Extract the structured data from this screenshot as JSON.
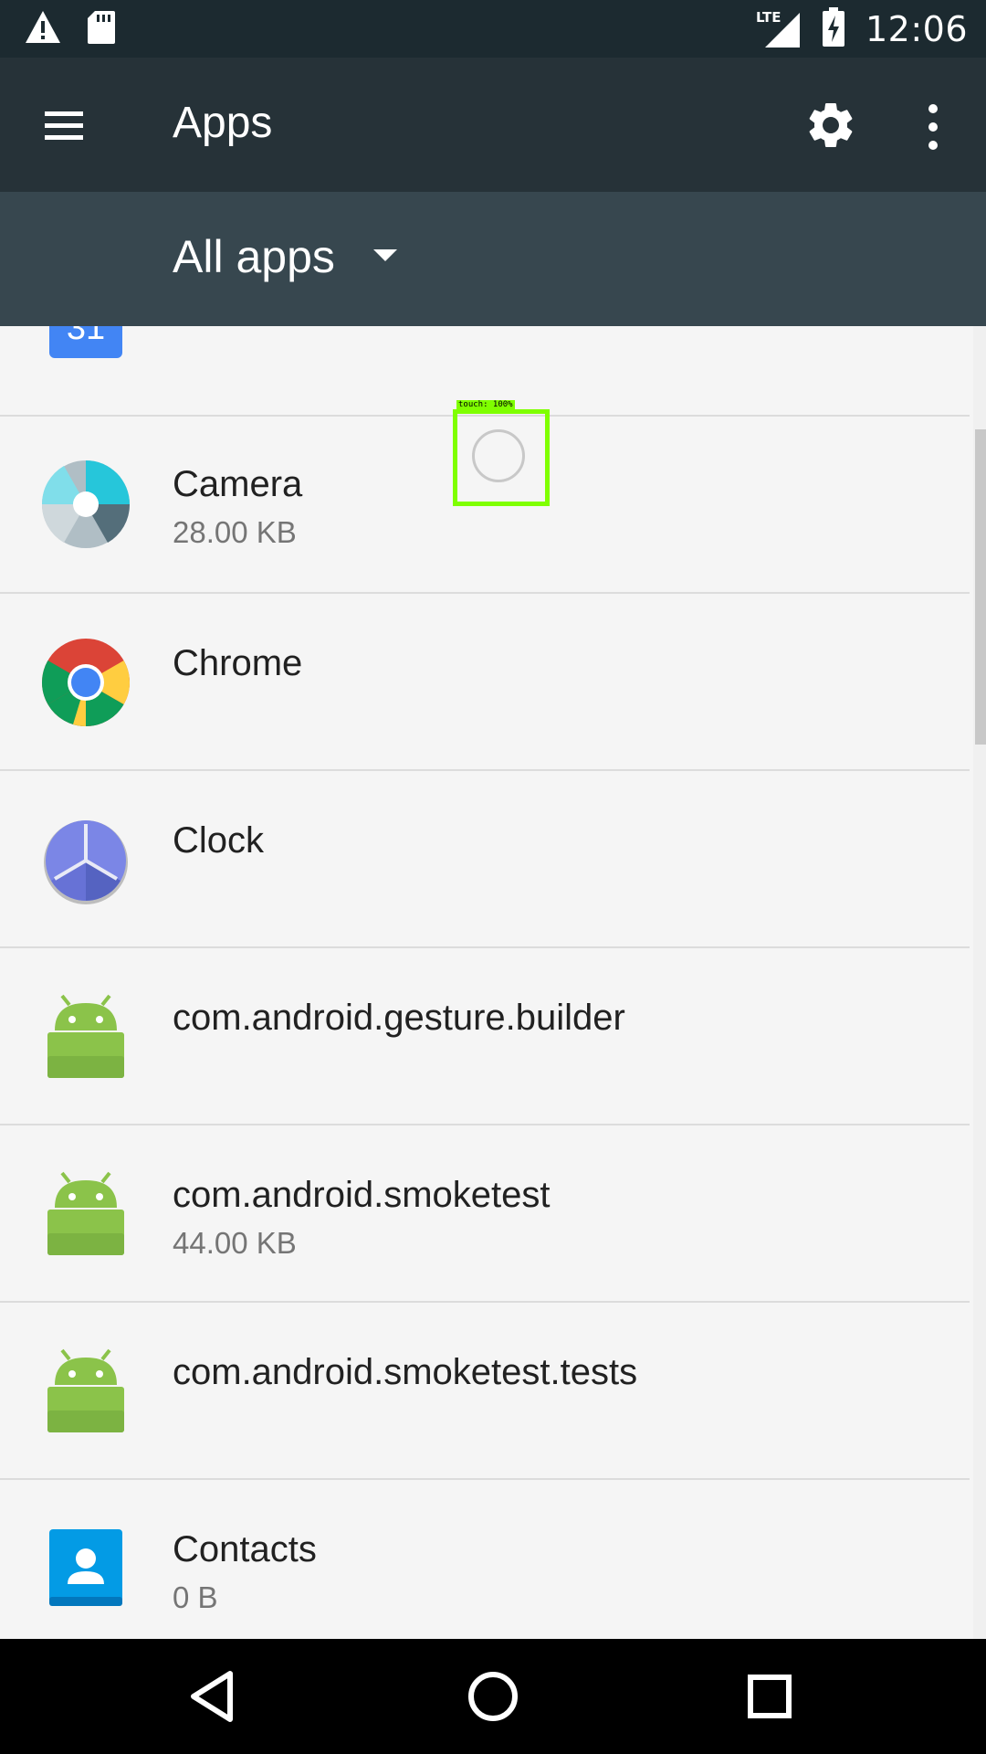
{
  "status_bar": {
    "time": "12:06",
    "network_label": "LTE",
    "icons": [
      "warning-icon",
      "sd-card-icon",
      "signal-icon",
      "battery-charging-icon"
    ]
  },
  "toolbar": {
    "title": "Apps",
    "icons": [
      "menu-icon",
      "gear-icon",
      "more-vert-icon"
    ]
  },
  "filter": {
    "selected": "All apps",
    "icon": "dropdown-arrow-icon"
  },
  "apps": [
    {
      "name": "",
      "size": "",
      "icon": "calendar-icon",
      "calendar_day": "31"
    },
    {
      "name": "Camera",
      "size": "28.00 KB",
      "icon": "camera-icon"
    },
    {
      "name": "Chrome",
      "size": "",
      "icon": "chrome-icon"
    },
    {
      "name": "Clock",
      "size": "",
      "icon": "clock-icon"
    },
    {
      "name": "com.android.gesture.builder",
      "size": "",
      "icon": "android-icon"
    },
    {
      "name": "com.android.smoketest",
      "size": "44.00 KB",
      "icon": "android-icon"
    },
    {
      "name": "com.android.smoketest.tests",
      "size": "",
      "icon": "android-icon"
    },
    {
      "name": "Contacts",
      "size": "0 B",
      "icon": "contacts-icon"
    }
  ],
  "touch_overlay": {
    "label": "touch: 100%"
  },
  "nav_bar": {
    "icons": [
      "back-icon",
      "home-icon",
      "recents-icon"
    ]
  },
  "colors": {
    "status_bar": "#1c2a30",
    "toolbar": "#263238",
    "spinner_bar": "#37474f",
    "list_bg": "#f5f5f5",
    "android_green": "#8bc34a",
    "touch_box": "#7fff00"
  }
}
